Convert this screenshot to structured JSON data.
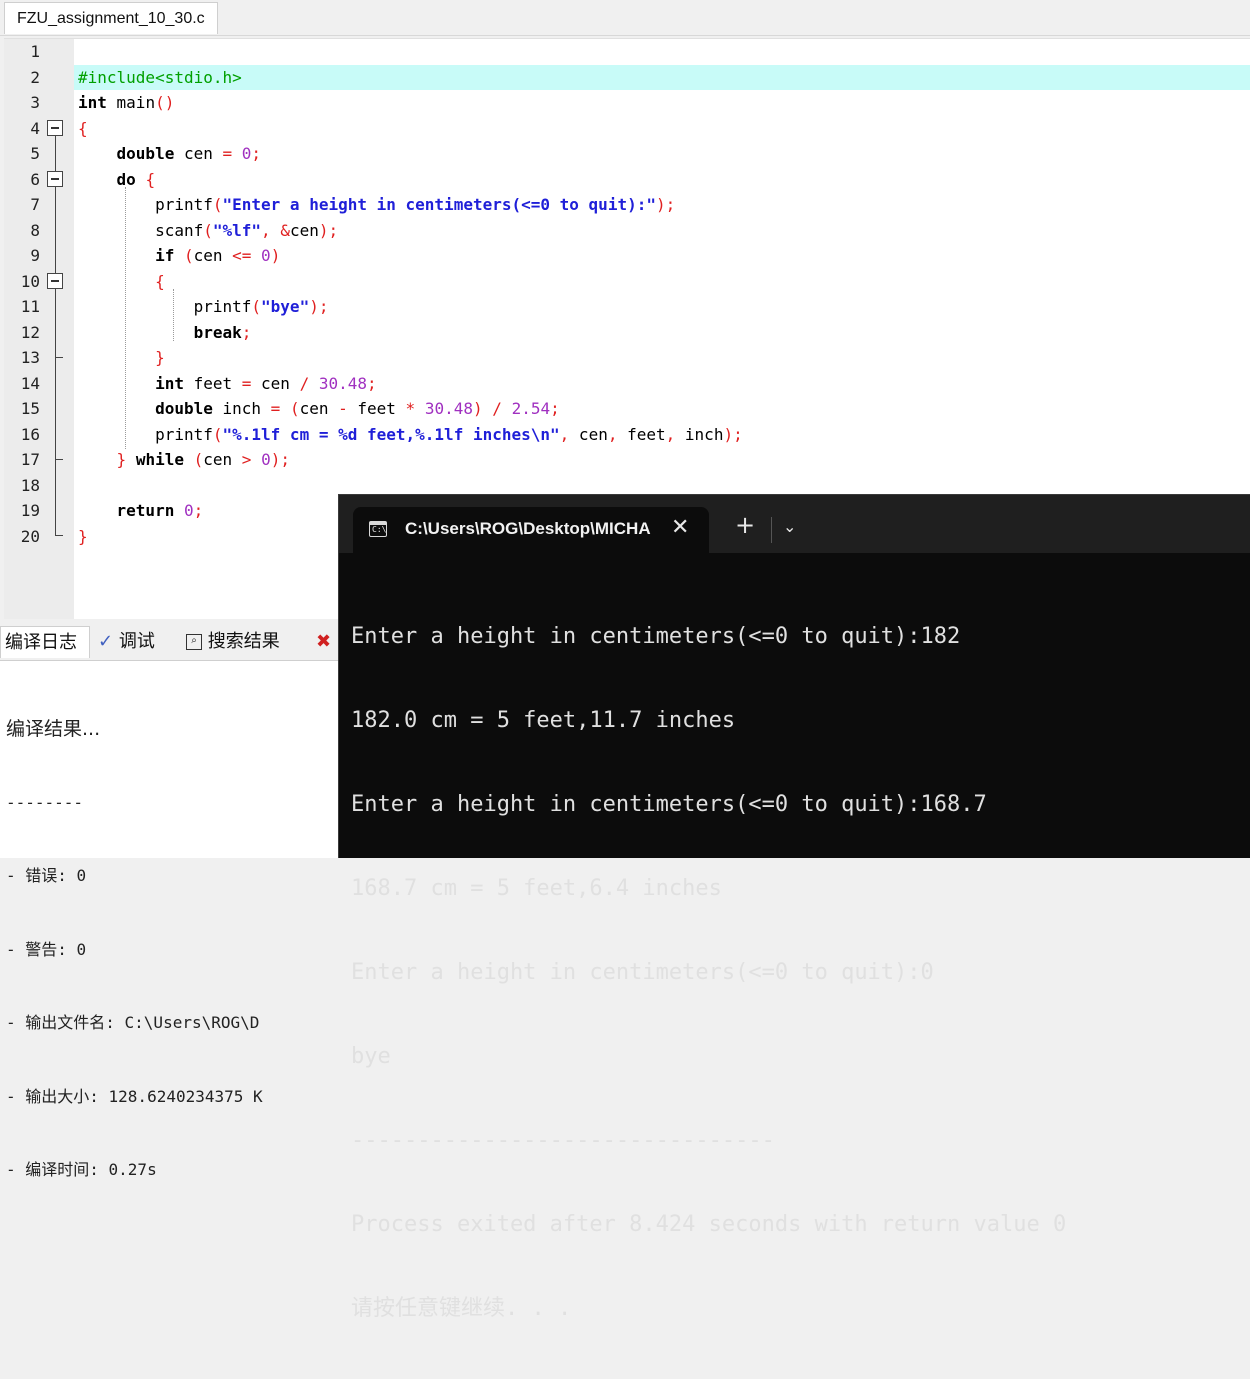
{
  "editor": {
    "file_tab": "FZU_assignment_10_30.c",
    "line_numbers": [
      "1",
      "2",
      "3",
      "4",
      "5",
      "6",
      "7",
      "8",
      "9",
      "10",
      "11",
      "12",
      "13",
      "14",
      "15",
      "16",
      "17",
      "18",
      "19",
      "20"
    ]
  },
  "bottom_panel": {
    "tabs": [
      "编译日志",
      "调试",
      "搜索结果"
    ],
    "log": [
      "编译结果...",
      "--------",
      "- 错误: 0",
      "- 警告: 0",
      "- 输出文件名: C:\\Users\\ROG\\D",
      "- 输出大小: 128.6240234375 K",
      "- 编译时间: 0.27s"
    ]
  },
  "terminal": {
    "tab_title": "C:\\Users\\ROG\\Desktop\\MICHA",
    "output": [
      "Enter a height in centimeters(<=0 to quit):182",
      "182.0 cm = 5 feet,11.7 inches",
      "Enter a height in centimeters(<=0 to quit):168.7",
      "168.7 cm = 5 feet,6.4 inches",
      "Enter a height in centimeters(<=0 to quit):0",
      "bye",
      "--------------------------------",
      "Process exited after 8.424 seconds with return value 0",
      "请按任意键继续. . ."
    ]
  },
  "icons": [
    "close-icon",
    "plus-icon",
    "chevron-down-icon",
    "terminal-icon",
    "fold-minus-icon",
    "checkmark-icon",
    "search-icon",
    "close-red-icon"
  ],
  "colors": {
    "current_line": "#c8fbf8",
    "keyword": "#000000",
    "preprocessor": "#00a000",
    "string": "#1f1fd8",
    "number": "#a030c0",
    "symbol": "#e02020",
    "terminal_bg": "#0c0c0c"
  }
}
